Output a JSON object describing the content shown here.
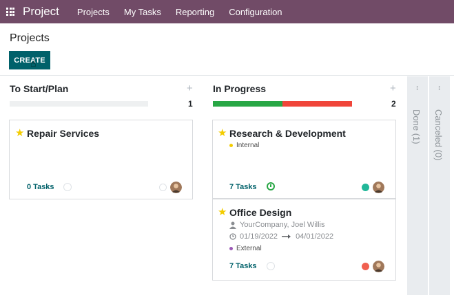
{
  "navbar": {
    "app_name": "Project",
    "menu": [
      "Projects",
      "My Tasks",
      "Reporting",
      "Configuration"
    ]
  },
  "control_panel": {
    "title": "Projects",
    "create_label": "CREATE"
  },
  "columns": [
    {
      "title": "To Start/Plan",
      "count": "1",
      "plus": "+",
      "progress": {
        "green": 0,
        "red": 0
      },
      "cards": [
        {
          "title": "Repair Services",
          "tasks_label": "0 Tasks"
        }
      ]
    },
    {
      "title": "In Progress",
      "count": "2",
      "plus": "+",
      "progress": {
        "green": 0.5,
        "red": 0.5
      },
      "cards": [
        {
          "title": "Research & Development",
          "tag": "Internal",
          "tasks_label": "7 Tasks"
        },
        {
          "title": "Office Design",
          "customer": "YourCompany, Joel Willis",
          "date_start": "01/19/2022",
          "date_end": "04/01/2022",
          "tag": "External",
          "tasks_label": "7 Tasks"
        }
      ]
    }
  ],
  "folded_columns": [
    {
      "label": "Done (1)",
      "arrow": "↔"
    },
    {
      "label": "Canceled (0)",
      "arrow": "↔"
    }
  ],
  "colors": {
    "navbar": "#714b67",
    "primary_button": "#00616a",
    "progress_green": "#28a745",
    "progress_red": "#f0453a",
    "tag_internal": "#f3cc00",
    "tag_external": "#9b59b6",
    "status_green": "#21b799",
    "status_orange": "#f06050",
    "star": "#f3cc00"
  },
  "icons": {
    "apps": "apps-grid-icon",
    "star": "star-icon",
    "user": "user-icon",
    "clock": "clock-icon",
    "arrow": "arrow-right-icon"
  }
}
